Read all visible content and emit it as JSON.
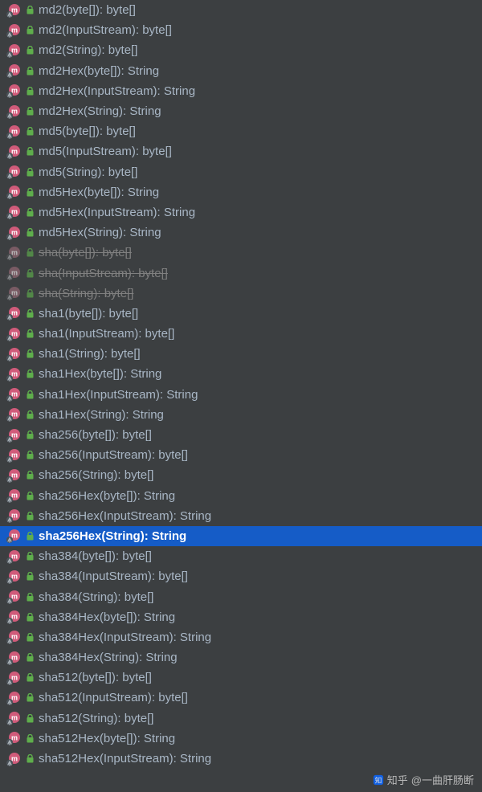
{
  "colors": {
    "bg": "#3c3f41",
    "text": "#a9b7c6",
    "selectedBg": "#155cc7",
    "iconPink": "#d05b7a",
    "iconArrow": "#6a7580",
    "lockGreen": "#5fae4c"
  },
  "watermark": {
    "prefix": "知乎",
    "handle": "@一曲肝肠断"
  },
  "methods": [
    {
      "signature": "md2(byte[]): byte[]",
      "deprecated": false,
      "selected": false
    },
    {
      "signature": "md2(InputStream): byte[]",
      "deprecated": false,
      "selected": false
    },
    {
      "signature": "md2(String): byte[]",
      "deprecated": false,
      "selected": false
    },
    {
      "signature": "md2Hex(byte[]): String",
      "deprecated": false,
      "selected": false
    },
    {
      "signature": "md2Hex(InputStream): String",
      "deprecated": false,
      "selected": false
    },
    {
      "signature": "md2Hex(String): String",
      "deprecated": false,
      "selected": false
    },
    {
      "signature": "md5(byte[]): byte[]",
      "deprecated": false,
      "selected": false
    },
    {
      "signature": "md5(InputStream): byte[]",
      "deprecated": false,
      "selected": false
    },
    {
      "signature": "md5(String): byte[]",
      "deprecated": false,
      "selected": false
    },
    {
      "signature": "md5Hex(byte[]): String",
      "deprecated": false,
      "selected": false
    },
    {
      "signature": "md5Hex(InputStream): String",
      "deprecated": false,
      "selected": false
    },
    {
      "signature": "md5Hex(String): String",
      "deprecated": false,
      "selected": false
    },
    {
      "signature": "sha(byte[]): byte[]",
      "deprecated": true,
      "selected": false
    },
    {
      "signature": "sha(InputStream): byte[]",
      "deprecated": true,
      "selected": false
    },
    {
      "signature": "sha(String): byte[]",
      "deprecated": true,
      "selected": false
    },
    {
      "signature": "sha1(byte[]): byte[]",
      "deprecated": false,
      "selected": false
    },
    {
      "signature": "sha1(InputStream): byte[]",
      "deprecated": false,
      "selected": false
    },
    {
      "signature": "sha1(String): byte[]",
      "deprecated": false,
      "selected": false
    },
    {
      "signature": "sha1Hex(byte[]): String",
      "deprecated": false,
      "selected": false
    },
    {
      "signature": "sha1Hex(InputStream): String",
      "deprecated": false,
      "selected": false
    },
    {
      "signature": "sha1Hex(String): String",
      "deprecated": false,
      "selected": false
    },
    {
      "signature": "sha256(byte[]): byte[]",
      "deprecated": false,
      "selected": false
    },
    {
      "signature": "sha256(InputStream): byte[]",
      "deprecated": false,
      "selected": false
    },
    {
      "signature": "sha256(String): byte[]",
      "deprecated": false,
      "selected": false
    },
    {
      "signature": "sha256Hex(byte[]): String",
      "deprecated": false,
      "selected": false
    },
    {
      "signature": "sha256Hex(InputStream): String",
      "deprecated": false,
      "selected": false
    },
    {
      "signature": "sha256Hex(String): String",
      "deprecated": false,
      "selected": true
    },
    {
      "signature": "sha384(byte[]): byte[]",
      "deprecated": false,
      "selected": false
    },
    {
      "signature": "sha384(InputStream): byte[]",
      "deprecated": false,
      "selected": false
    },
    {
      "signature": "sha384(String): byte[]",
      "deprecated": false,
      "selected": false
    },
    {
      "signature": "sha384Hex(byte[]): String",
      "deprecated": false,
      "selected": false
    },
    {
      "signature": "sha384Hex(InputStream): String",
      "deprecated": false,
      "selected": false
    },
    {
      "signature": "sha384Hex(String): String",
      "deprecated": false,
      "selected": false
    },
    {
      "signature": "sha512(byte[]): byte[]",
      "deprecated": false,
      "selected": false
    },
    {
      "signature": "sha512(InputStream): byte[]",
      "deprecated": false,
      "selected": false
    },
    {
      "signature": "sha512(String): byte[]",
      "deprecated": false,
      "selected": false
    },
    {
      "signature": "sha512Hex(byte[]): String",
      "deprecated": false,
      "selected": false
    },
    {
      "signature": "sha512Hex(InputStream): String",
      "deprecated": false,
      "selected": false
    }
  ]
}
